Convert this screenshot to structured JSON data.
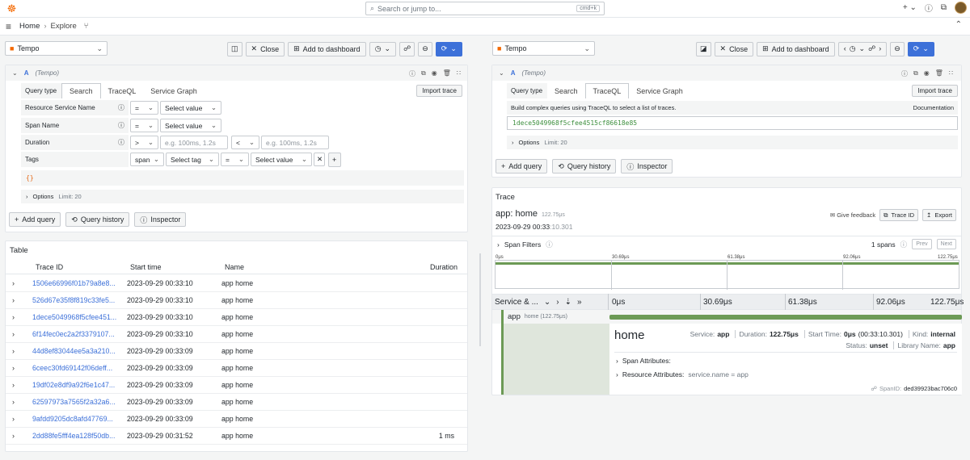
{
  "topbar": {
    "search_placeholder": "Search or jump to...",
    "shortcut": "cmd+k",
    "plus_label": "+"
  },
  "breadcrumb": {
    "home": "Home",
    "current": "Explore"
  },
  "left": {
    "datasource": "Tempo",
    "close_label": "Close",
    "add_dashboard_label": "Add to dashboard",
    "query_letter": "A",
    "query_ds": "(Tempo)",
    "query_type_label": "Query type",
    "tabs": [
      "Search",
      "TraceQL",
      "Service Graph"
    ],
    "import_trace": "Import trace",
    "rows": {
      "resource_service_name": "Resource Service Name",
      "span_name": "Span Name",
      "duration": "Duration",
      "tags": "Tags"
    },
    "eq": "=",
    "gt": ">",
    "lt": "<",
    "select_value": "Select value",
    "select_tag": "Select tag",
    "span_scope": "span",
    "duration_placeholder": "e.g. 100ms, 1.2s",
    "query_preview": "{}",
    "options_label": "Options",
    "options_limit": "Limit: 20",
    "add_query": "Add query",
    "query_history": "Query history",
    "inspector": "Inspector"
  },
  "table": {
    "title": "Table",
    "headers": {
      "trace_id": "Trace ID",
      "start_time": "Start time",
      "name": "Name",
      "duration": "Duration"
    },
    "rows": [
      {
        "trace_id": "1506e66996f01b79a8e8...",
        "start": "2023-09-29 00:33:10",
        "name": "app home",
        "duration": ""
      },
      {
        "trace_id": "526d67e35f8f819c33fe5...",
        "start": "2023-09-29 00:33:10",
        "name": "app home",
        "duration": ""
      },
      {
        "trace_id": "1dece5049968f5cfee451...",
        "start": "2023-09-29 00:33:10",
        "name": "app home",
        "duration": ""
      },
      {
        "trace_id": "6f14fec0ec2a2f3379107...",
        "start": "2023-09-29 00:33:10",
        "name": "app home",
        "duration": ""
      },
      {
        "trace_id": "44d8ef83044ee5a3a210...",
        "start": "2023-09-29 00:33:09",
        "name": "app home",
        "duration": ""
      },
      {
        "trace_id": "6ceec30fd69142f06deff...",
        "start": "2023-09-29 00:33:09",
        "name": "app home",
        "duration": ""
      },
      {
        "trace_id": "19df02e8df9a92f6e1c47...",
        "start": "2023-09-29 00:33:09",
        "name": "app home",
        "duration": ""
      },
      {
        "trace_id": "62597973a7565f2a32a6...",
        "start": "2023-09-29 00:33:09",
        "name": "app home",
        "duration": ""
      },
      {
        "trace_id": "9afdd9205dc8afd47769...",
        "start": "2023-09-29 00:33:09",
        "name": "app home",
        "duration": ""
      },
      {
        "trace_id": "2dd88fe5fff4ea128f50db...",
        "start": "2023-09-29 00:31:52",
        "name": "app home",
        "duration": "1 ms"
      }
    ]
  },
  "right": {
    "datasource": "Tempo",
    "close_label": "Close",
    "add_dashboard_label": "Add to dashboard",
    "query_letter": "A",
    "query_ds": "(Tempo)",
    "query_type_label": "Query type",
    "tabs": [
      "Search",
      "TraceQL",
      "Service Graph"
    ],
    "import_trace": "Import trace",
    "traceql_help": "Build complex queries using TraceQL to select a list of traces.",
    "documentation": "Documentation",
    "traceql_query": "1dece5049968f5cfee4515cf86618e85",
    "options_label": "Options",
    "options_limit": "Limit: 20",
    "add_query": "Add query",
    "query_history": "Query history",
    "inspector": "Inspector"
  },
  "trace": {
    "panel_title": "Trace",
    "trace_name": "app: home",
    "trace_duration": "122.75μs",
    "date_main": "2023-09-29 00:33",
    "date_sec": ":10.301",
    "give_feedback": "Give feedback",
    "trace_id_btn": "Trace ID",
    "export_btn": "Export",
    "span_filters": "Span Filters",
    "span_count": "1 spans",
    "prev": "Prev",
    "next": "Next",
    "ticks": [
      "0μs",
      "30.69μs",
      "61.38μs",
      "92.06μs",
      "122.75μs"
    ],
    "col_header": "Service & ...",
    "span_service": "app",
    "span_op": "home (122.75μs)",
    "detail": {
      "name": "home",
      "service_label": "Service:",
      "service": "app",
      "duration_label": "Duration:",
      "duration": "122.75μs",
      "start_label": "Start Time:",
      "start": "0μs",
      "start_abs": "(00:33:10.301)",
      "kind_label": "Kind:",
      "kind": "internal",
      "status_label": "Status:",
      "status": "unset",
      "library_label": "Library Name:",
      "library": "app",
      "span_attributes": "Span Attributes:",
      "resource_attributes": "Resource Attributes:",
      "resource_attr_kv": "service.name = app",
      "span_id_label": "SpanID:",
      "span_id": "ded39923bac706c0"
    }
  },
  "colors": {
    "accent": "#3d71d9",
    "span_bar": "#6c9a55",
    "brand": "#f46800"
  }
}
